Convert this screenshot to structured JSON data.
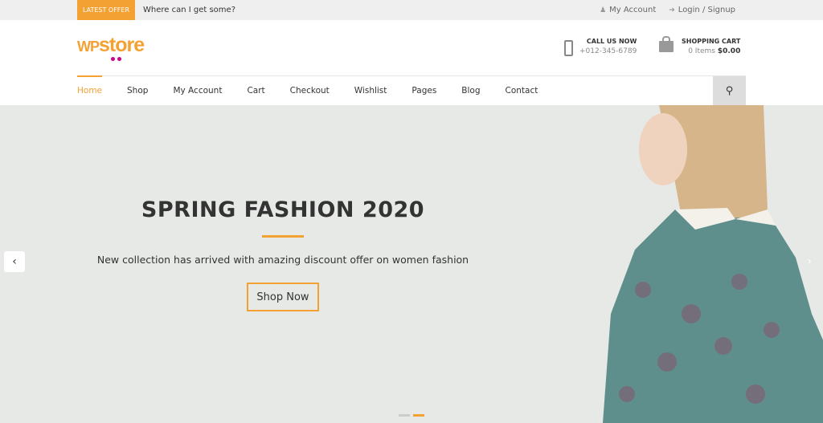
{
  "topbar": {
    "offer_label": "LATEST OFFER",
    "offer_text": "Where can I get some?",
    "my_account": "My Account",
    "login": "Login / Signup"
  },
  "header": {
    "logo_wp": "WP",
    "logo_store": "store",
    "call_label": "CALL US NOW",
    "phone": "+012-345-6789",
    "cart_label": "SHOPPING CART",
    "cart_items": "0 Items",
    "cart_total": "$0.00"
  },
  "nav": {
    "items": [
      "Home",
      "Shop",
      "My Account",
      "Cart",
      "Checkout",
      "Wishlist",
      "Pages",
      "Blog",
      "Contact"
    ]
  },
  "hero": {
    "title": "SPRING FASHION 2020",
    "description": "New collection has arrived with amazing discount offer on women fashion",
    "button": "Shop Now"
  },
  "colors": {
    "accent": "#f4a133",
    "hero_bg": "#e6e9e5"
  }
}
